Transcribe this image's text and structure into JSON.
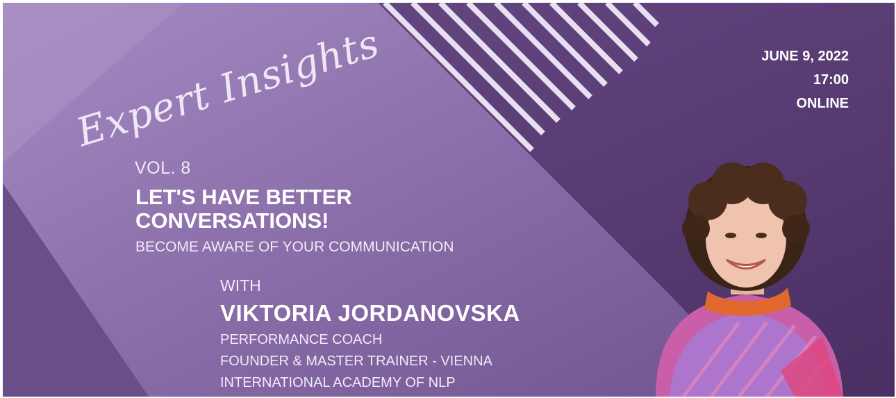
{
  "event": {
    "script_title": "Expert Insights",
    "volume": "VOL. 8",
    "headline_line1": "LET'S HAVE BETTER",
    "headline_line2": "CONVERSATIONS!",
    "subheadline": "BECOME AWARE OF YOUR COMMUNICATION",
    "date": "JUNE 9, 2022",
    "time": "17:00",
    "location": "ONLINE"
  },
  "speaker": {
    "with_label": "WITH",
    "name": "VIKTORIA JORDANOVSKA",
    "role_line1": "PERFORMANCE COACH",
    "role_line2": "FOUNDER & MASTER TRAINER - VIENNA",
    "role_line3": "INTERNATIONAL ACADEMY OF NLP"
  },
  "colors": {
    "background_dark": "#5c3f77",
    "background_light": "#9a80b8",
    "stripe": "#e8dff1",
    "text": "#ffffff"
  }
}
